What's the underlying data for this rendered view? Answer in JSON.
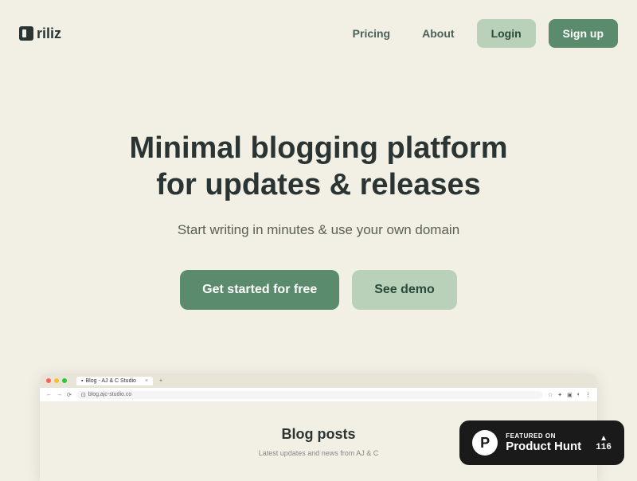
{
  "brand": {
    "name": "riliz"
  },
  "nav": {
    "pricing": "Pricing",
    "about": "About",
    "login": "Login",
    "signup": "Sign up"
  },
  "hero": {
    "title_line1": "Minimal blogging platform",
    "title_line2": "for updates & releases",
    "subtitle": "Start writing in minutes & use your own domain",
    "cta_primary": "Get started for free",
    "cta_secondary": "See demo"
  },
  "browser": {
    "tab_title": "Blog - AJ & C Studio",
    "url": "blog.ajc-studio.co",
    "blog_title": "Blog posts",
    "blog_subtitle": "Latest updates and news from AJ & C"
  },
  "product_hunt": {
    "featured": "FEATURED ON",
    "name": "Product Hunt",
    "count": "116"
  }
}
